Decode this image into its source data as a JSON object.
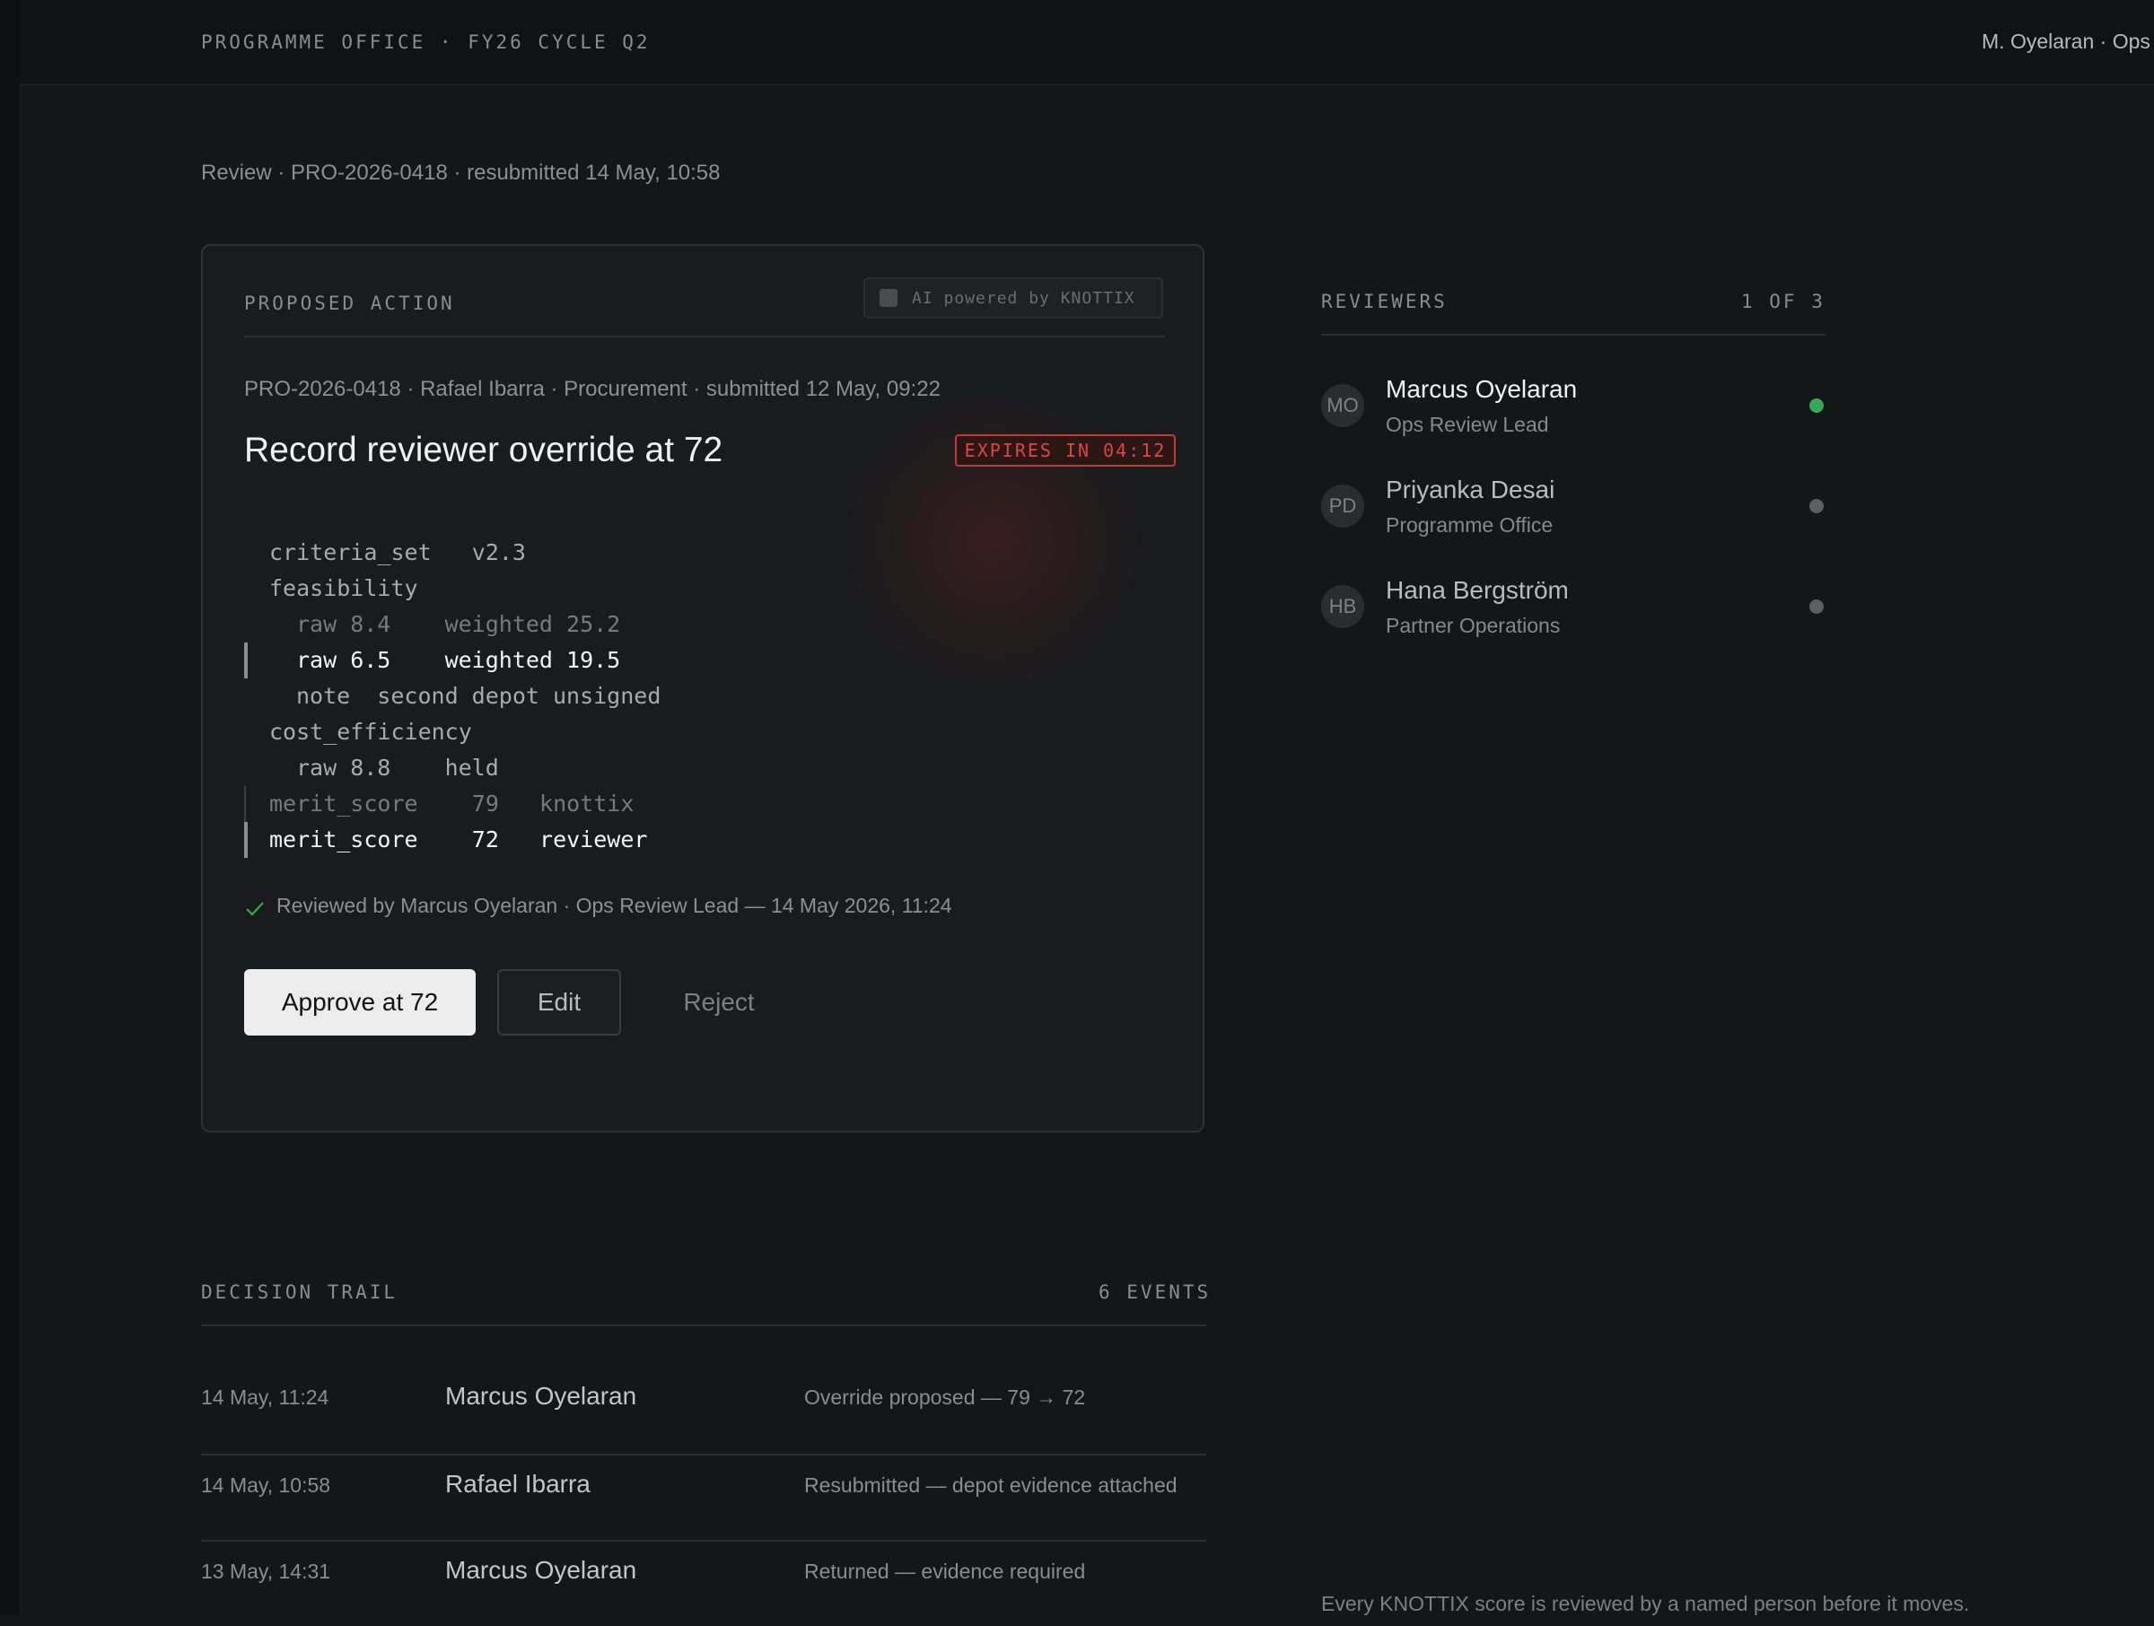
{
  "topbar": {
    "office_label": "PROGRAMME OFFICE · FY26 CYCLE Q2",
    "user": "M. Oyelaran · Ops"
  },
  "breadcrumb": "Review · PRO-2026-0418 · resubmitted 14 May, 10:58",
  "proposal": {
    "section_label": "PROPOSED ACTION",
    "ai_badge": "AI powered by KNOTTIX",
    "meta": "PRO-2026-0418 · Rafael Ibarra · Procurement · submitted 12 May, 09:22",
    "title": "Record reviewer override at 72",
    "expires": "EXPIRES IN 04:12",
    "code_lines": [
      "criteria_set   v2.3",
      "feasibility",
      "raw 8.4    weighted 25.2",
      "raw 6.5    weighted 19.5",
      "note  second depot unsigned",
      "cost_efficiency",
      "raw 8.8    held",
      "merit_score    79   knottix",
      "merit_score    72   reviewer"
    ],
    "reviewed_note": "Reviewed by Marcus Oyelaran · Ops Review Lead — 14 May 2026, 11:24",
    "approve_label": "Approve at 72",
    "edit_label": "Edit",
    "reject_label": "Reject"
  },
  "reviewers": {
    "section_label": "REVIEWERS",
    "count": "1 OF 3",
    "items": [
      {
        "initials": "MO",
        "name": "Marcus Oyelaran",
        "role": "Ops Review Lead",
        "status": "active"
      },
      {
        "initials": "PD",
        "name": "Priyanka Desai",
        "role": "Programme Office",
        "status": "pending"
      },
      {
        "initials": "HB",
        "name": "Hana Bergström",
        "role": "Partner Operations",
        "status": "pending"
      }
    ]
  },
  "trail": {
    "section_label": "DECISION TRAIL",
    "count": "6 EVENTS",
    "rows": [
      {
        "time": "14 May, 11:24",
        "who": "Marcus Oyelaran",
        "event": "Override proposed — 79 → 72"
      },
      {
        "time": "14 May, 10:58",
        "who": "Rafael Ibarra",
        "event": "Resubmitted — depot evidence attached"
      },
      {
        "time": "13 May, 14:31",
        "who": "Marcus Oyelaran",
        "event": "Returned — evidence required"
      }
    ]
  },
  "footnote": "Every KNOTTIX score is reviewed by a named person before it moves.",
  "colors": {
    "background": "#151617",
    "expires_red": "#e0463d",
    "active_green": "#34a853",
    "approve_bg": "#ececec"
  }
}
